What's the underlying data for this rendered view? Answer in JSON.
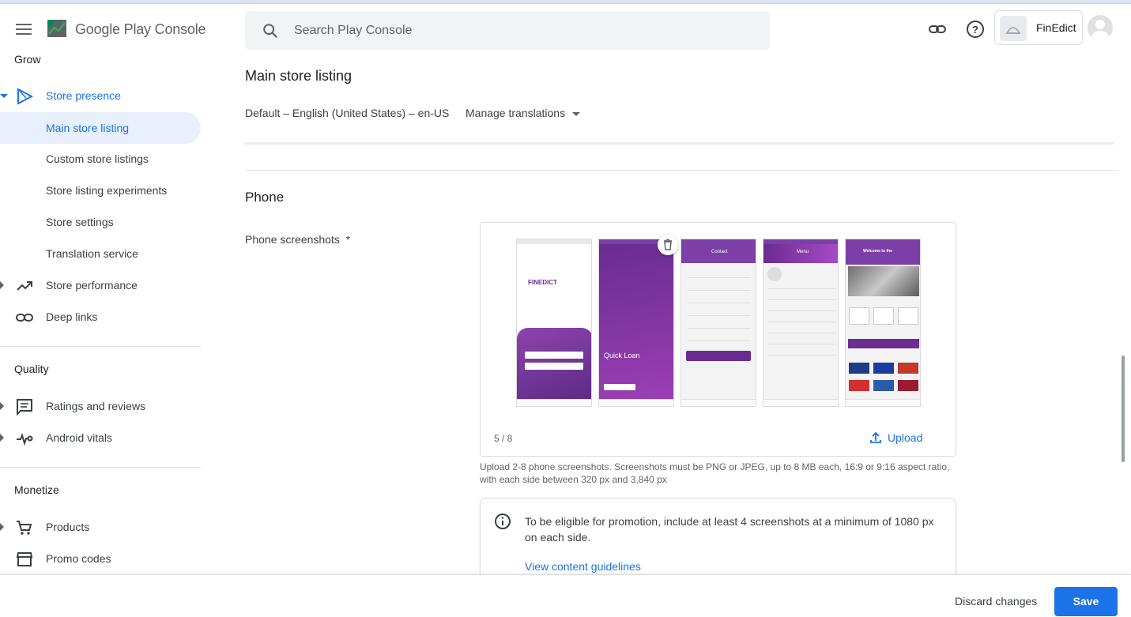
{
  "app": {
    "brand": "Google Play Console",
    "account_name": "FinEdict"
  },
  "search": {
    "placeholder": "Search Play Console"
  },
  "sidebar": {
    "section_grow": "Grow",
    "store_presence": "Store presence",
    "items_store_presence": [
      "Main store listing",
      "Custom store listings",
      "Store listing experiments",
      "Store settings",
      "Translation service"
    ],
    "store_performance": "Store performance",
    "deep_links": "Deep links",
    "section_quality": "Quality",
    "ratings_reviews": "Ratings and reviews",
    "android_vitals": "Android vitals",
    "section_monetize": "Monetize",
    "products": "Products",
    "promo_codes": "Promo codes"
  },
  "main": {
    "title": "Main store listing",
    "language": "Default – English (United States) – en-US",
    "manage_translations": "Manage translations",
    "phone_heading": "Phone",
    "screenshots_label": "Phone screenshots  *",
    "screenshot_count": "5 / 8",
    "upload_label": "Upload",
    "help_text": "Upload 2-8 phone screenshots. Screenshots must be PNG or JPEG, up to 8 MB each, 16:9 or 9:16 aspect ratio, with each side between 320 px and 3,840 px",
    "info_text": "To be eligible for promotion, include at least 4 screenshots at a minimum of 1080 px on each side.",
    "info_link": "View content guidelines",
    "screens": {
      "s1_brand": "FINEDICT",
      "s2_title": "Quick Loan",
      "s3_title": "Contact",
      "s4_title": "Menu",
      "s5_title": "Welcome to the"
    }
  },
  "footer": {
    "discard": "Discard changes",
    "save": "Save"
  },
  "colors": {
    "accent": "#1a73e8",
    "selected_bg": "#e8f0fe",
    "app_purple": "#7b3fa6"
  }
}
